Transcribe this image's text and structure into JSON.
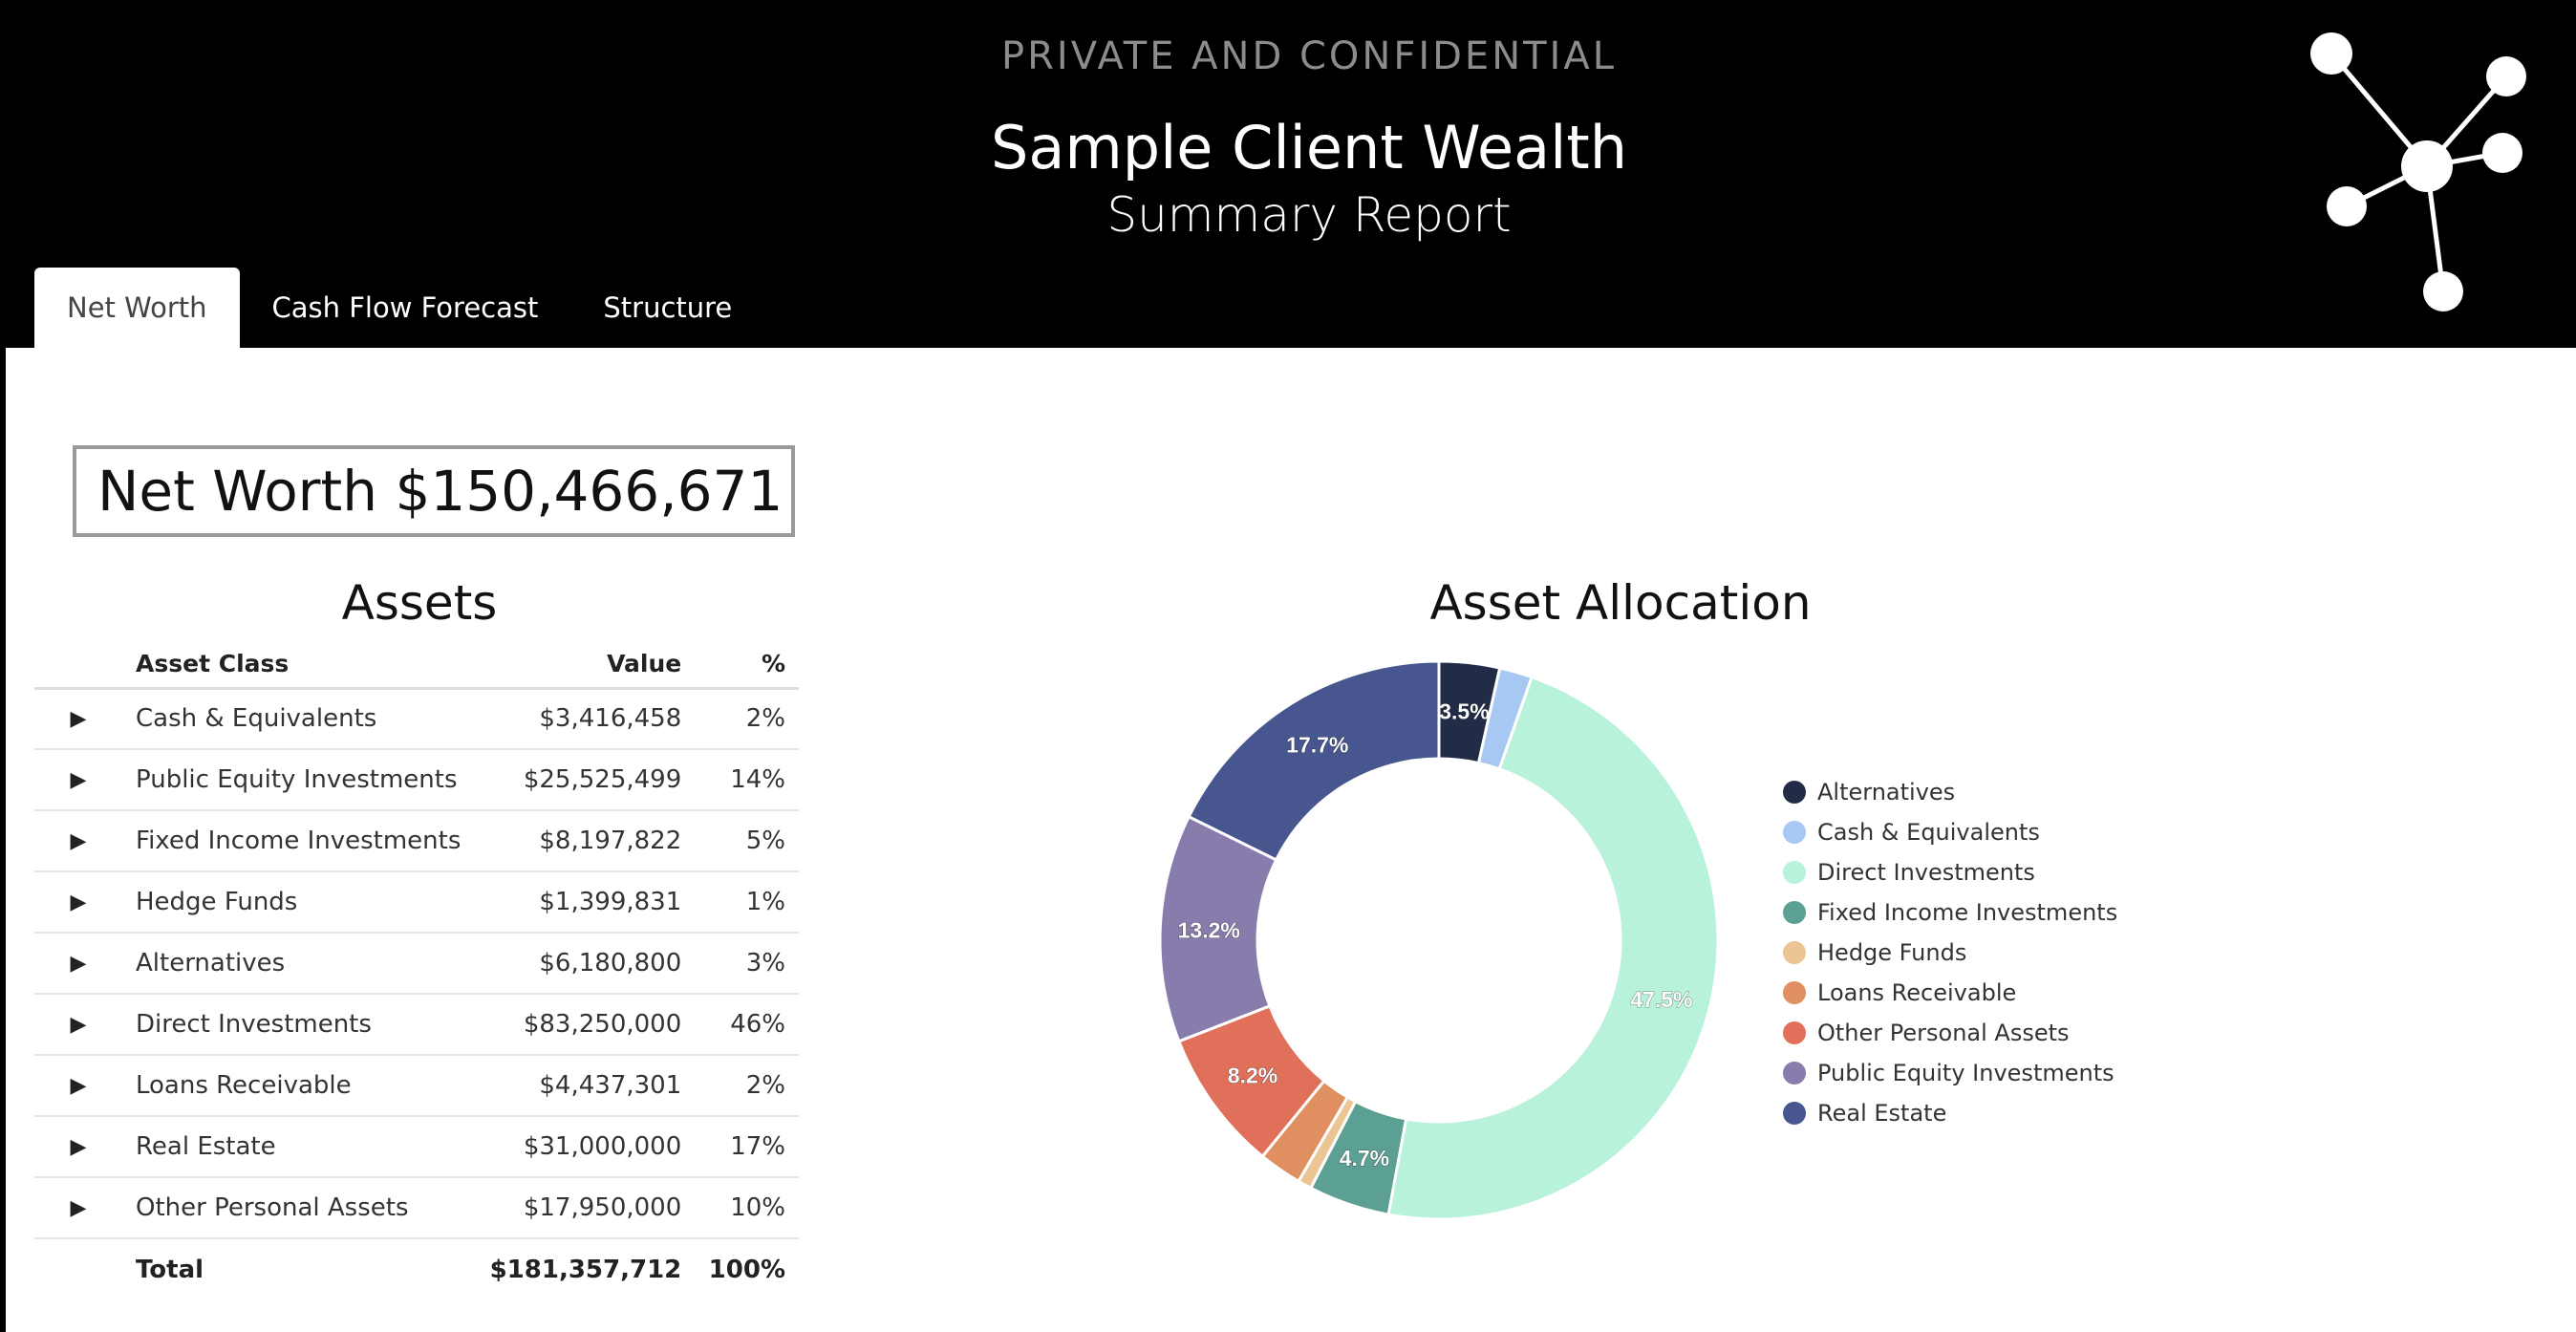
{
  "header": {
    "confidential": "PRIVATE AND CONFIDENTIAL",
    "title": "Sample Client Wealth",
    "subtitle": "Summary Report",
    "logo_icon": "molecule-network-icon"
  },
  "tabs": [
    {
      "label": "Net Worth",
      "active": true
    },
    {
      "label": "Cash Flow Forecast",
      "active": false
    },
    {
      "label": "Structure",
      "active": false
    }
  ],
  "net_worth": {
    "text": "Net Worth $150,466,671"
  },
  "assets": {
    "title": "Assets",
    "columns": {
      "asset_class": "Asset Class",
      "value": "Value",
      "percent": "%"
    },
    "rows": [
      {
        "asset_class": "Cash & Equivalents",
        "value": "$3,416,458",
        "percent": "2%"
      },
      {
        "asset_class": "Public Equity Investments",
        "value": "$25,525,499",
        "percent": "14%"
      },
      {
        "asset_class": "Fixed Income Investments",
        "value": "$8,197,822",
        "percent": "5%"
      },
      {
        "asset_class": "Hedge Funds",
        "value": "$1,399,831",
        "percent": "1%"
      },
      {
        "asset_class": "Alternatives",
        "value": "$6,180,800",
        "percent": "3%"
      },
      {
        "asset_class": "Direct Investments",
        "value": "$83,250,000",
        "percent": "46%"
      },
      {
        "asset_class": "Loans Receivable",
        "value": "$4,437,301",
        "percent": "2%"
      },
      {
        "asset_class": "Real Estate",
        "value": "$31,000,000",
        "percent": "17%"
      },
      {
        "asset_class": "Other Personal Assets",
        "value": "$17,950,000",
        "percent": "10%"
      }
    ],
    "total": {
      "label": "Total",
      "value": "$181,357,712",
      "percent": "100%"
    }
  },
  "chart_data": {
    "type": "pie",
    "title": "Asset Allocation",
    "donut": true,
    "legend_position": "right",
    "slices": [
      {
        "label": "Alternatives",
        "value": 3.5,
        "color": "#232c47",
        "data_label": "3.5%"
      },
      {
        "label": "Cash & Equivalents",
        "value": 1.9,
        "color": "#a8c8f4",
        "data_label": ""
      },
      {
        "label": "Direct Investments",
        "value": 47.5,
        "color": "#b8f2da",
        "data_label": "47.5%"
      },
      {
        "label": "Fixed Income Investments",
        "value": 4.7,
        "color": "#5ba092",
        "data_label": "4.7%"
      },
      {
        "label": "Hedge Funds",
        "value": 0.8,
        "color": "#ebc593",
        "data_label": ""
      },
      {
        "label": "Loans Receivable",
        "value": 2.5,
        "color": "#e09060",
        "data_label": ""
      },
      {
        "label": "Other Personal Assets",
        "value": 8.2,
        "color": "#e0705a",
        "data_label": "8.2%"
      },
      {
        "label": "Public Equity Investments",
        "value": 13.2,
        "color": "#877cab",
        "data_label": "13.2%"
      },
      {
        "label": "Real Estate",
        "value": 17.7,
        "color": "#47568e",
        "data_label": "17.7%"
      }
    ]
  }
}
